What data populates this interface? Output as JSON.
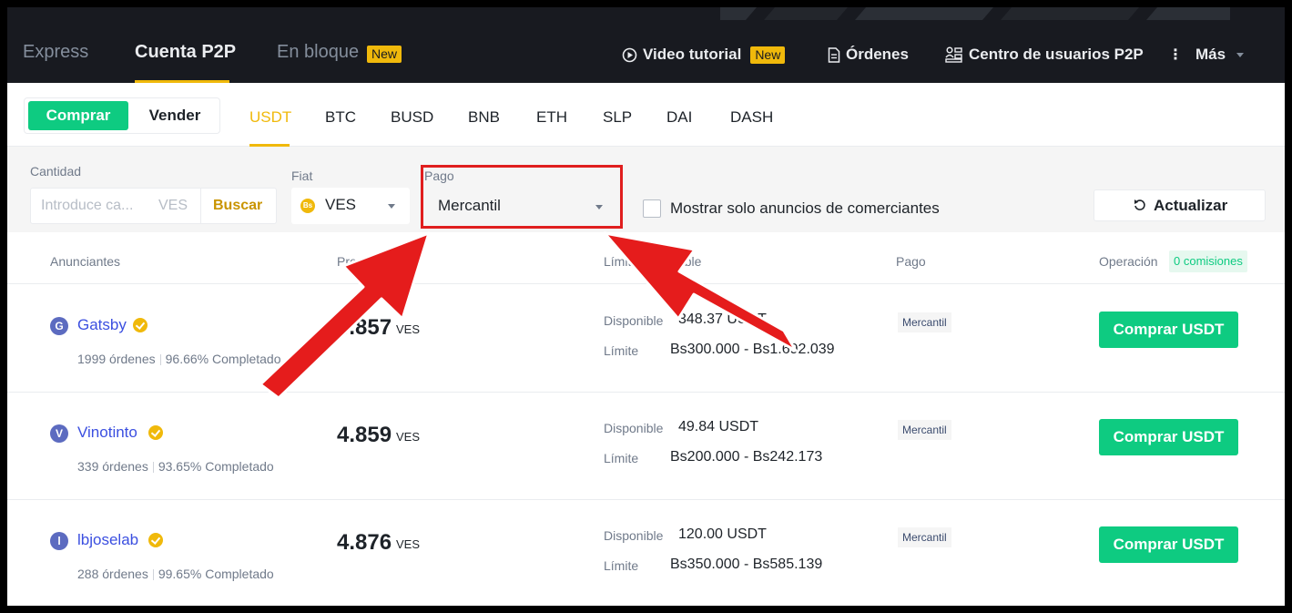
{
  "nav": {
    "express": "Express",
    "cuenta_p2p": "Cuenta P2P",
    "en_bloque": "En bloque",
    "new_badge": "New",
    "video_tutorial": "Video tutorial",
    "video_badge": "New",
    "ordenes": "Órdenes",
    "centro": "Centro de usuarios P2P",
    "mas": "Más"
  },
  "trade": {
    "buy": "Comprar",
    "sell": "Vender",
    "coins": [
      "USDT",
      "BTC",
      "BUSD",
      "BNB",
      "ETH",
      "SLP",
      "DAI",
      "DASH"
    ],
    "active_coin": "USDT"
  },
  "filters": {
    "cantidad_label": "Cantidad",
    "cantidad_placeholder": "Introduce ca...",
    "cantidad_currency": "VES",
    "buscar": "Buscar",
    "fiat_label": "Fiat",
    "fiat_icon": "Bs",
    "fiat_value": "VES",
    "pago_label": "Pago",
    "pago_value": "Mercantil",
    "merchant_only": "Mostrar solo anuncios de comerciantes",
    "refresh": "Actualizar"
  },
  "table": {
    "headers": {
      "anunciantes": "Anunciantes",
      "precio": "Precio",
      "limite": "Límite/Disponible",
      "pago": "Pago",
      "operacion": "Operación",
      "comisiones": "0 comisiones"
    },
    "rows": [
      {
        "initial": "G",
        "name": "Gatsby",
        "orders": "1999 órdenes",
        "completion": "96.66% Completado",
        "price": "4.857",
        "currency": "VES",
        "disponible_label": "Disponible",
        "disponible": "348.37 USDT",
        "limite_label": "Límite",
        "limite": "Bs300.000 - Bs1.692.039",
        "payment": "Mercantil",
        "action": "Comprar USDT"
      },
      {
        "initial": "V",
        "name": "Vinotinto",
        "orders": "339 órdenes",
        "completion": "93.65% Completado",
        "price": "4.859",
        "currency": "VES",
        "disponible_label": "Disponible",
        "disponible": "49.84 USDT",
        "limite_label": "Límite",
        "limite": "Bs200.000 - Bs242.173",
        "payment": "Mercantil",
        "action": "Comprar USDT"
      },
      {
        "initial": "l",
        "name": "lbjoselab",
        "orders": "288 órdenes",
        "completion": "99.65% Completado",
        "price": "4.876",
        "currency": "VES",
        "disponible_label": "Disponible",
        "disponible": "120.00 USDT",
        "limite_label": "Límite",
        "limite": "Bs350.000 - Bs585.139",
        "payment": "Mercantil",
        "action": "Comprar USDT"
      }
    ]
  },
  "colors": {
    "brand_yellow": "#f0b90b",
    "buy_green": "#0ecb81",
    "annotation_red": "#e01e1e"
  }
}
